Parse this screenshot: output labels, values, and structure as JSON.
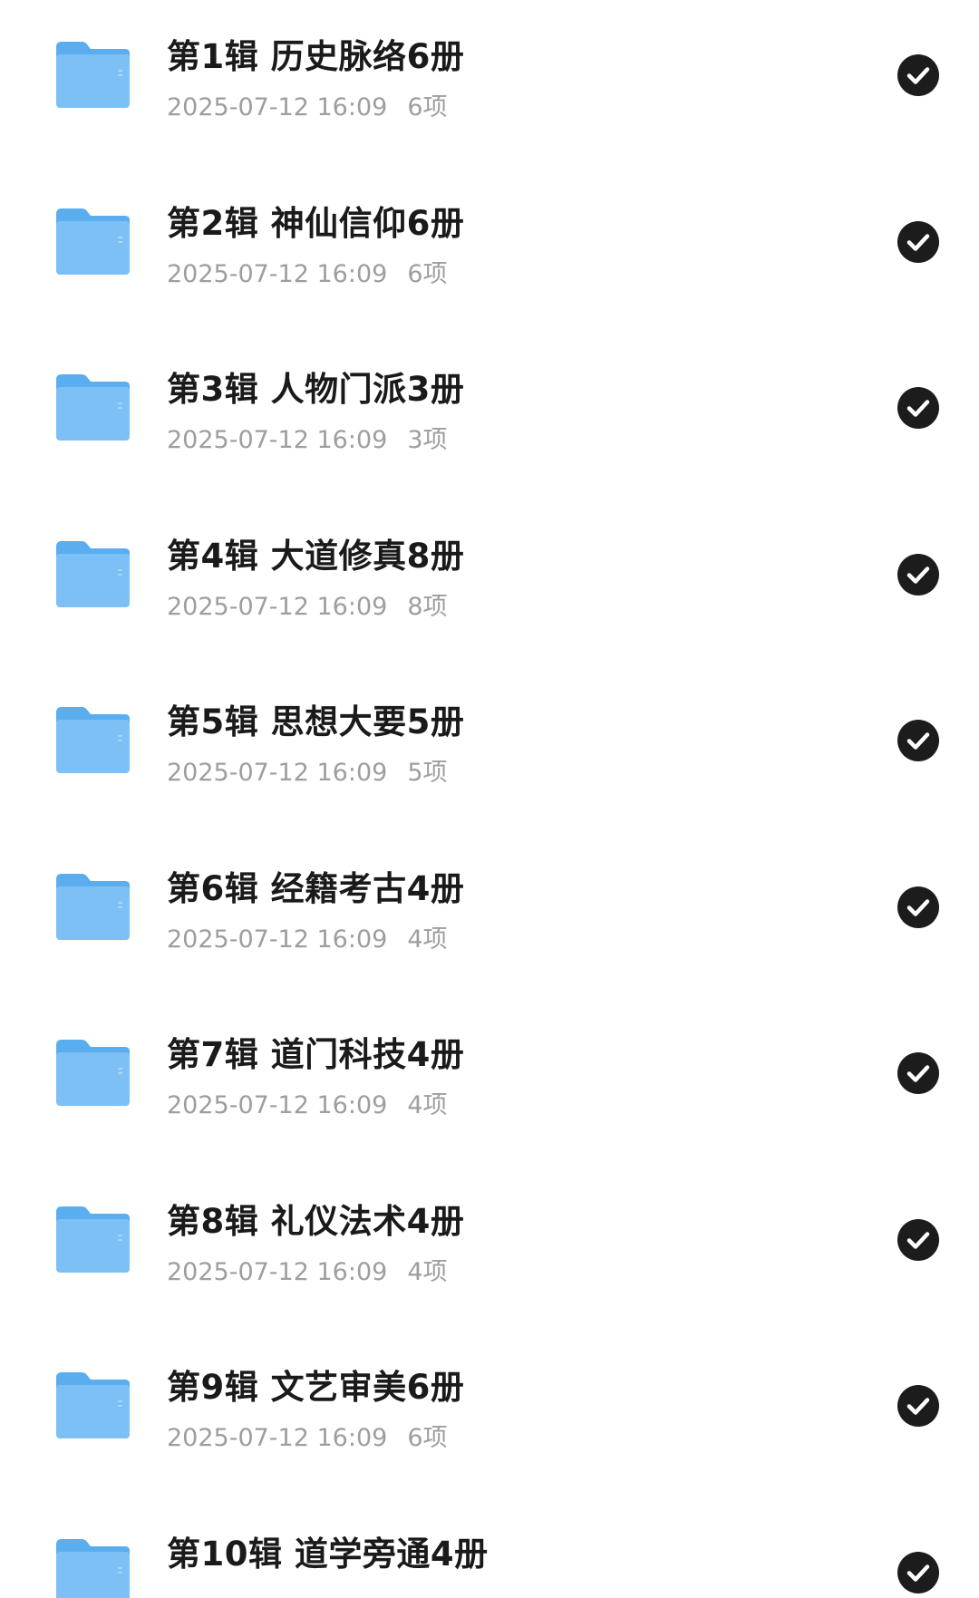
{
  "accent_color": "#1c1c1c",
  "folder_color": "#7cc0f5",
  "folders": [
    {
      "title": "第1辑 历史脉络6册",
      "date": "2025-07-12 16:09",
      "count": "6项",
      "selected": true
    },
    {
      "title": "第2辑 神仙信仰6册",
      "date": "2025-07-12 16:09",
      "count": "6项",
      "selected": true
    },
    {
      "title": "第3辑 人物门派3册",
      "date": "2025-07-12 16:09",
      "count": "3项",
      "selected": true
    },
    {
      "title": "第4辑 大道修真8册",
      "date": "2025-07-12 16:09",
      "count": "8项",
      "selected": true
    },
    {
      "title": "第5辑 思想大要5册",
      "date": "2025-07-12 16:09",
      "count": "5项",
      "selected": true
    },
    {
      "title": "第6辑 经籍考古4册",
      "date": "2025-07-12 16:09",
      "count": "4项",
      "selected": true
    },
    {
      "title": "第7辑 道门科技4册",
      "date": "2025-07-12 16:09",
      "count": "4项",
      "selected": true
    },
    {
      "title": "第8辑 礼仪法术4册",
      "date": "2025-07-12 16:09",
      "count": "4项",
      "selected": true
    },
    {
      "title": "第9辑 文艺审美6册",
      "date": "2025-07-12 16:09",
      "count": "6项",
      "selected": true
    },
    {
      "title": "第10辑 道学旁通4册",
      "date": "",
      "count": "",
      "selected": true
    }
  ]
}
